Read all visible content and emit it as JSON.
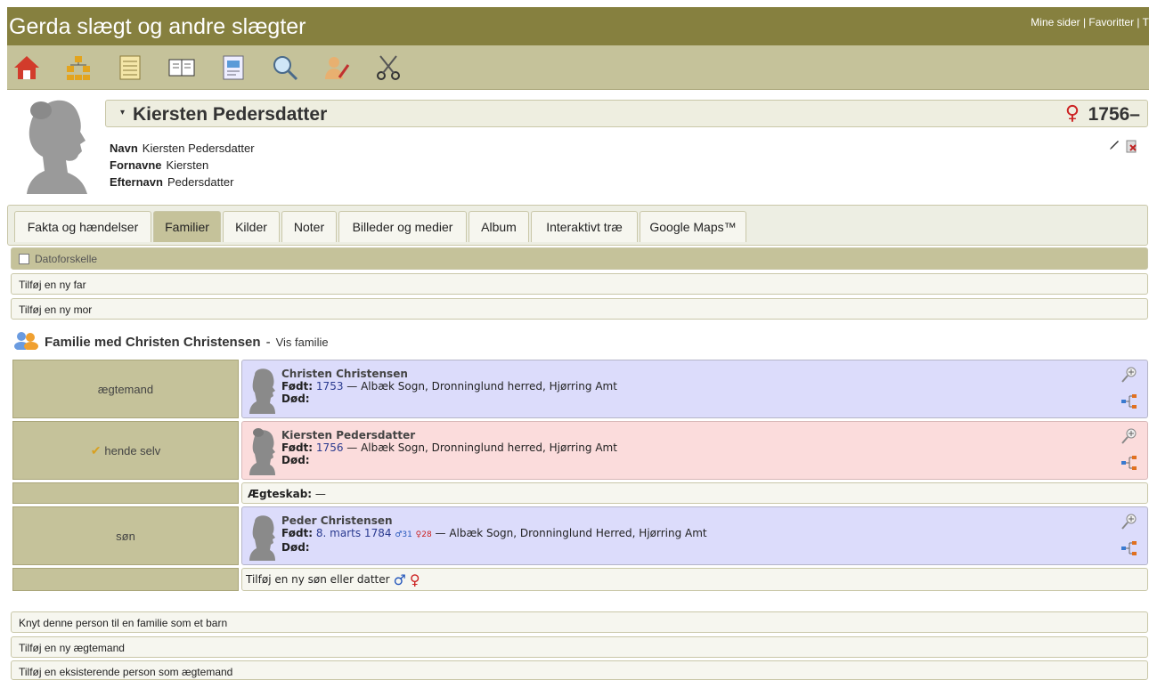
{
  "site": {
    "title": "Gerda slægt og andre slægter",
    "links": "Mine sider | Favoritter | T"
  },
  "toolbar": {
    "icons": [
      "home-icon",
      "pedigree-icon",
      "list-icon",
      "book-icon",
      "report-icon",
      "search-icon",
      "edit-person-icon",
      "scissors-icon"
    ]
  },
  "person": {
    "name": "Kiersten Pedersdatter",
    "sex_symbol": "♀",
    "years": "1756–",
    "facts": [
      {
        "label": "Navn",
        "value": "Kiersten Pedersdatter"
      },
      {
        "label": "Fornavne",
        "value": "Kiersten"
      },
      {
        "label": "Efternavn",
        "value": "Pedersdatter"
      }
    ]
  },
  "tabs": [
    {
      "label": "Fakta og hændelser"
    },
    {
      "label": "Familier"
    },
    {
      "label": "Kilder"
    },
    {
      "label": "Noter"
    },
    {
      "label": "Billeder og medier"
    },
    {
      "label": "Album"
    },
    {
      "label": "Interaktivt træ"
    },
    {
      "label": "Google Maps™"
    }
  ],
  "active_tab": "Familier",
  "date_filter_label": "Datoforskelle",
  "parents": {
    "add_father": "Tilføj en ny far",
    "add_mother": "Tilføj en ny mor"
  },
  "family": {
    "title": "Familie med Christen Christensen",
    "separator": " - ",
    "show": "Vis familie",
    "members": [
      {
        "role": "ægtemand",
        "name": "Christen Christensen",
        "born_label": "Født:",
        "born_year": "1753",
        "born_place": " — Albæk Sogn, Dronninglund herred, Hjørring Amt",
        "died_label": "Død:"
      },
      {
        "role": "hende selv",
        "name": "Kiersten Pedersdatter",
        "born_label": "Født:",
        "born_year": "1756",
        "born_place": " — Albæk Sogn, Dronninglund herred, Hjørring Amt",
        "died_label": "Død:"
      },
      {
        "role": "søn",
        "name": "Peder Christensen",
        "born_label": "Født:",
        "born_year": "8. marts 1784",
        "father_age": "♂31",
        "mother_age": "♀28",
        "born_place": " — Albæk Sogn, Dronninglund Herred, Hjørring Amt",
        "died_label": "Død:"
      }
    ],
    "marriage_label": "Ægteskab:",
    "marriage_value": " —",
    "add_child": "Tilføj en ny søn eller datter"
  },
  "actions": {
    "link_as_child": "Knyt denne person til en familie som et barn",
    "add_husband": "Tilføj en ny ægtemand",
    "add_existing_husband": "Tilføj en eksisterende person som ægtemand"
  },
  "colors": {
    "header": "#86803f",
    "toolbar": "#c5c29a",
    "male_bg": "#dcdcfb",
    "female_bg": "#fbdcdc"
  }
}
